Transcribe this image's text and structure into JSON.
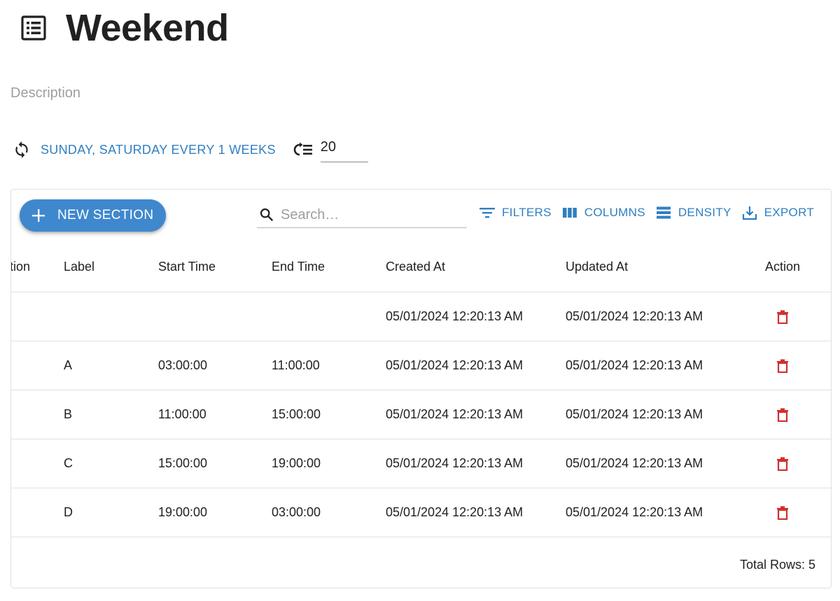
{
  "page": {
    "title": "Weekend",
    "title_icon": "list-alt-icon",
    "description_placeholder": "Description"
  },
  "schedule": {
    "recurrence_icon": "sync-icon",
    "recurrence_text": "SUNDAY, SATURDAY EVERY 1 WEEKS",
    "count_icon": "format-list-numbered-icon",
    "count_value": "20"
  },
  "toolbar": {
    "new_section_label": "NEW SECTION",
    "search_placeholder": "Search…",
    "filters_label": "FILTERS",
    "columns_label": "COLUMNS",
    "density_label": "DENSITY",
    "export_label": "EXPORT"
  },
  "table": {
    "columns": {
      "description": "ption",
      "label": "Label",
      "start_time": "Start Time",
      "end_time": "End Time",
      "created_at": "Created At",
      "updated_at": "Updated At",
      "action": "Action"
    },
    "rows": [
      {
        "label": "",
        "start_time": "",
        "end_time": "",
        "created_at": "05/01/2024 12:20:13 AM",
        "updated_at": "05/01/2024 12:20:13 AM"
      },
      {
        "label": "A",
        "start_time": "03:00:00",
        "end_time": "11:00:00",
        "created_at": "05/01/2024 12:20:13 AM",
        "updated_at": "05/01/2024 12:20:13 AM"
      },
      {
        "label": "B",
        "start_time": "11:00:00",
        "end_time": "15:00:00",
        "created_at": "05/01/2024 12:20:13 AM",
        "updated_at": "05/01/2024 12:20:13 AM"
      },
      {
        "label": "C",
        "start_time": "15:00:00",
        "end_time": "19:00:00",
        "created_at": "05/01/2024 12:20:13 AM",
        "updated_at": "05/01/2024 12:20:13 AM"
      },
      {
        "label": "D",
        "start_time": "19:00:00",
        "end_time": "03:00:00",
        "created_at": "05/01/2024 12:20:13 AM",
        "updated_at": "05/01/2024 12:20:13 AM"
      }
    ]
  },
  "footer": {
    "total_rows": "Total Rows: 5"
  },
  "colors": {
    "accent": "#2f7fc1",
    "fab": "#3f88cd",
    "delete": "#d32f2f"
  }
}
